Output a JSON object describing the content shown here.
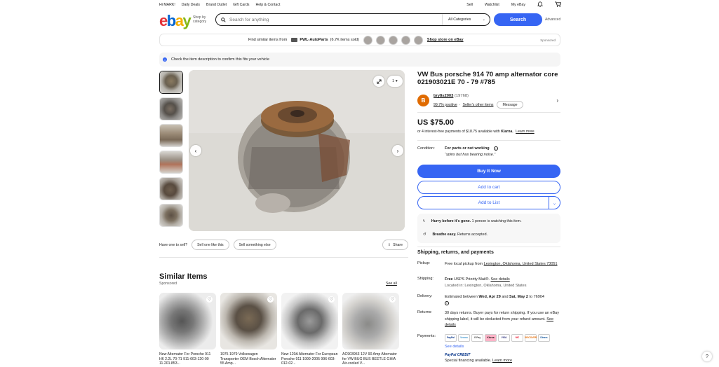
{
  "topbar": {
    "greeting": "Hi MARK!",
    "links": [
      "Daily Deals",
      "Brand Outlet",
      "Gift Cards",
      "Help & Contact"
    ],
    "sell": "Sell",
    "watchlist": "Watchlist",
    "myebay": "My eBay"
  },
  "header": {
    "shop_by": "Shop by",
    "category": "category",
    "search_placeholder": "Search for anything",
    "all_categories": "All Categories",
    "search_button": "Search",
    "advanced": "Advanced"
  },
  "promo": {
    "prefix": "Find similar items from",
    "store": "PWL-AutoParts",
    "count": "(6.7K items sold)",
    "shop_store": "Shop store on eBay",
    "sponsored": "Sponsored"
  },
  "notice": "Check the item description to confirm this fits your vehicle",
  "gallery": {
    "watch_count": "1"
  },
  "actions": {
    "have_one": "Have one to sell?",
    "sell_like": "Sell one like this",
    "sell_else": "Sell something else",
    "share": "Share"
  },
  "item": {
    "title": "VW Bus porsche 914 70 amp alternator core 021903021E 70 - 79 #785",
    "seller_initial": "B",
    "seller_name": "bry8s2003",
    "seller_count": "(19768)",
    "positive": "99.7% positive",
    "other_items": "Seller's other items",
    "message": "Message",
    "price": "US $75.00",
    "klarna_text": "or 4 interest-free payments of $18.75 available with",
    "klarna_brand": "Klarna.",
    "learn_more": "Learn more",
    "condition_label": "Condition:",
    "condition_value": "For parts or not working",
    "condition_note": "“spins but has bearing noise.”",
    "buy_now": "Buy It Now",
    "add_cart": "Add to cart",
    "add_list": "Add to List",
    "hurry": "Hurry before it's gone.",
    "hurry_detail": "1 person is watching this item.",
    "breathe": "Breathe easy.",
    "breathe_detail": "Returns accepted."
  },
  "shipping": {
    "heading": "Shipping, returns, and payments",
    "pickup_label": "Pickup:",
    "pickup_text": "Free local pickup from",
    "pickup_link": "Lexington, Oklahoma, United States 73051",
    "shipping_label": "Shipping:",
    "free": "Free",
    "method": "USPS Priority Mail®.",
    "see_details": "See details",
    "located": "Located in: Lexington, Oklahoma, United States",
    "delivery_label": "Delivery:",
    "delivery_pre": "Estimated between",
    "delivery_d1": "Wed, Apr 29",
    "delivery_and": "and",
    "delivery_d2": "Sat, May 2",
    "delivery_to": "to 76904",
    "returns_label": "Returns:",
    "returns_text": "30 days returns. Buyer pays for return shipping. If you use an eBay shipping label, it will be deducted from your refund amount.",
    "returns_link": "See details",
    "payments_label": "Payments:",
    "payment_methods": [
      "PayPal",
      "Venmo",
      "G Pay",
      "Klarna",
      "VISA",
      "MC",
      "DISCOVER",
      "Diners"
    ],
    "payments_link": "See details",
    "paypal_credit": "PayPal CREDIT",
    "financing": "Special financing available.",
    "financing_link": "Learn more"
  },
  "similar": {
    "title": "Similar Items",
    "sponsored": "Sponsored",
    "see_all": "See all",
    "items": [
      {
        "title": "New Alternator For Porsche 911 H6 2.2L 70-71 911-603-120-00 11.201.853..."
      },
      {
        "title": "1975 1979 Volkswagen Transporter OEM Bosch Alternator 55 Amp..."
      },
      {
        "title": "New 120A Alternator For European Porsche 911 1999-2005 996-603-012-02..."
      },
      {
        "title": "AC903953 12V 90 Amp Alternator for VW BUG BUS BEETLE GHIA Air-cooled V..."
      }
    ]
  },
  "help": "?"
}
